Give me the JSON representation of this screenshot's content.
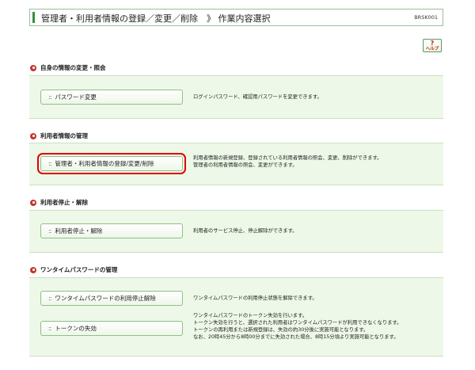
{
  "header": {
    "title": "管理者・利用者情報の登録／変更／削除　》 作業内容選択",
    "screen_code": "BRSK001"
  },
  "help": {
    "symbol": "?",
    "label": "ヘルプ"
  },
  "sections": [
    {
      "heading": "自身の情報の変更・照会",
      "items": [
        {
          "button": "パスワード変更",
          "desc": [
            "ログインパスワード、確認用パスワードを変更できます。"
          ]
        }
      ]
    },
    {
      "heading": "利用者情報の管理",
      "items": [
        {
          "button": "管理者・利用者情報の登録/変更/削除",
          "desc": [
            "利用者情報の新規登録、登録されている利用者情報の照会、変更、削除ができます。",
            "管理者の利用者情報の照会、変更ができます。"
          ]
        }
      ]
    },
    {
      "heading": "利用者停止・解除",
      "items": [
        {
          "button": "利用者停止・解除",
          "desc": [
            "利用者のサービス停止、停止解除ができます。"
          ]
        }
      ]
    },
    {
      "heading": "ワンタイムパスワードの管理",
      "items": [
        {
          "button": "ワンタイムパスワードの利用停止解除",
          "desc": [
            "ワンタイムパスワードの利用停止状態を解除できます。"
          ]
        },
        {
          "button": "トークンの失効",
          "desc": [
            "ワンタイムパスワードのトークン失効を行います。",
            "トークン失効を行うと、選択された利用者はワンタイムパスワードが利用できなくなります。",
            "トークンの再利用または新規登録は、失効の約30分後に実施可能となります。",
            "なお、20時45分から8時00分までに失効された場合、8時15分頃より実施可能となります。"
          ]
        }
      ]
    }
  ],
  "colors": {
    "accent_green": "#3a8f3a",
    "panel_bg": "#eef8e8",
    "bullet_red": "#c0392b",
    "highlight_red": "#e00000"
  },
  "selected_item": "管理者・利用者情報の登録/変更/削除"
}
